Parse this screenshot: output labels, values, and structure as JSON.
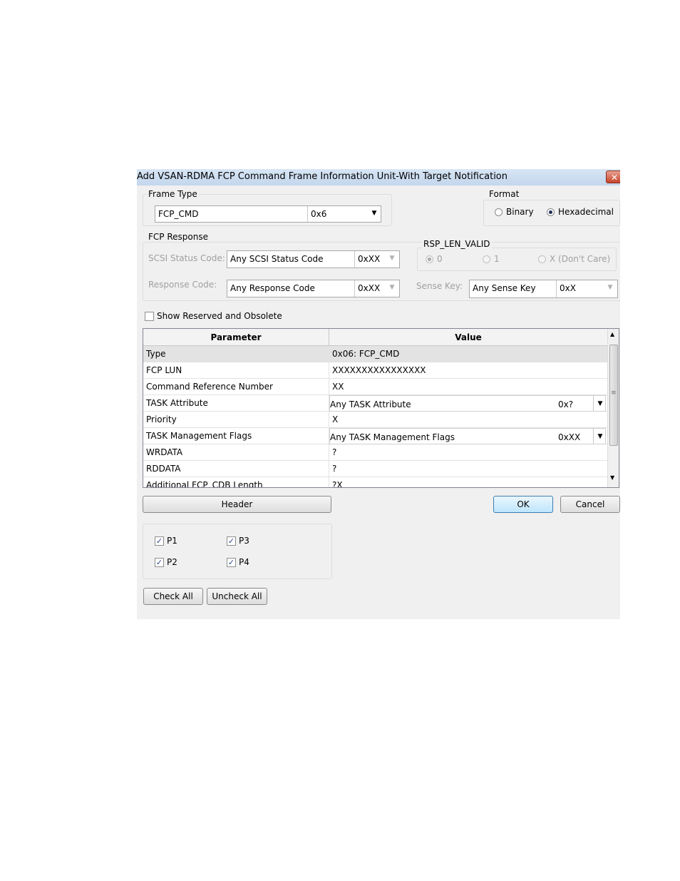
{
  "dialog": {
    "title": "Add VSAN-RDMA FCP Command Frame Information Unit-With Target Notification",
    "close_glyph": "✕"
  },
  "frame_type": {
    "legend": "Frame Type",
    "name": "FCP_CMD",
    "code": "0x6"
  },
  "format": {
    "legend": "Format",
    "options": [
      {
        "label": "Binary",
        "selected": false
      },
      {
        "label": "Hexadecimal",
        "selected": true
      }
    ]
  },
  "fcp_response": {
    "legend": "FCP Response",
    "scsi_status_label": "SCSI Status Code:",
    "scsi_status_value": "Any SCSI Status Code",
    "scsi_status_code": "0xXX",
    "response_code_label": "Response Code:",
    "response_code_value": "Any Response Code",
    "response_code_code": "0xXX"
  },
  "rsp_len_valid": {
    "legend": "RSP_LEN_VALID",
    "options": [
      {
        "label": "0",
        "selected": true
      },
      {
        "label": "1",
        "selected": false
      },
      {
        "label": "X (Don't Care)",
        "selected": false
      }
    ]
  },
  "sense_key": {
    "label": "Sense Key:",
    "value": "Any Sense Key",
    "code": "0xX"
  },
  "show_reserved": {
    "label": "Show Reserved and Obsolete",
    "checked": false
  },
  "table": {
    "headers": [
      "Parameter",
      "Value"
    ],
    "rows": [
      {
        "param": "Type",
        "value": "0x06: FCP_CMD"
      },
      {
        "param": "FCP LUN",
        "value": "XXXXXXXXXXXXXXXX"
      },
      {
        "param": "Command Reference Number",
        "value": "XX"
      },
      {
        "param": "TASK Attribute",
        "value": "Any TASK Attribute",
        "code": "0x?"
      },
      {
        "param": "Priority",
        "value": "X"
      },
      {
        "param": "TASK Management Flags",
        "value": "Any TASK Management Flags",
        "code": "0xXX"
      },
      {
        "param": "WRDATA",
        "value": "?"
      },
      {
        "param": "RDDATA",
        "value": "?"
      },
      {
        "param": "Additional FCP_CDB Length",
        "value": "?X"
      }
    ]
  },
  "buttons": {
    "header": "Header",
    "ok": "OK",
    "cancel": "Cancel",
    "check_all": "Check All",
    "uncheck_all": "Uncheck All"
  },
  "ports": [
    {
      "label": "P1",
      "checked": true
    },
    {
      "label": "P3",
      "checked": true
    },
    {
      "label": "P2",
      "checked": true
    },
    {
      "label": "P4",
      "checked": true
    }
  ],
  "check_glyph": "✓",
  "dropdown_glyph": "▼",
  "scroll_up_glyph": "▲",
  "scroll_down_glyph": "▼",
  "grip_glyph": "≡"
}
